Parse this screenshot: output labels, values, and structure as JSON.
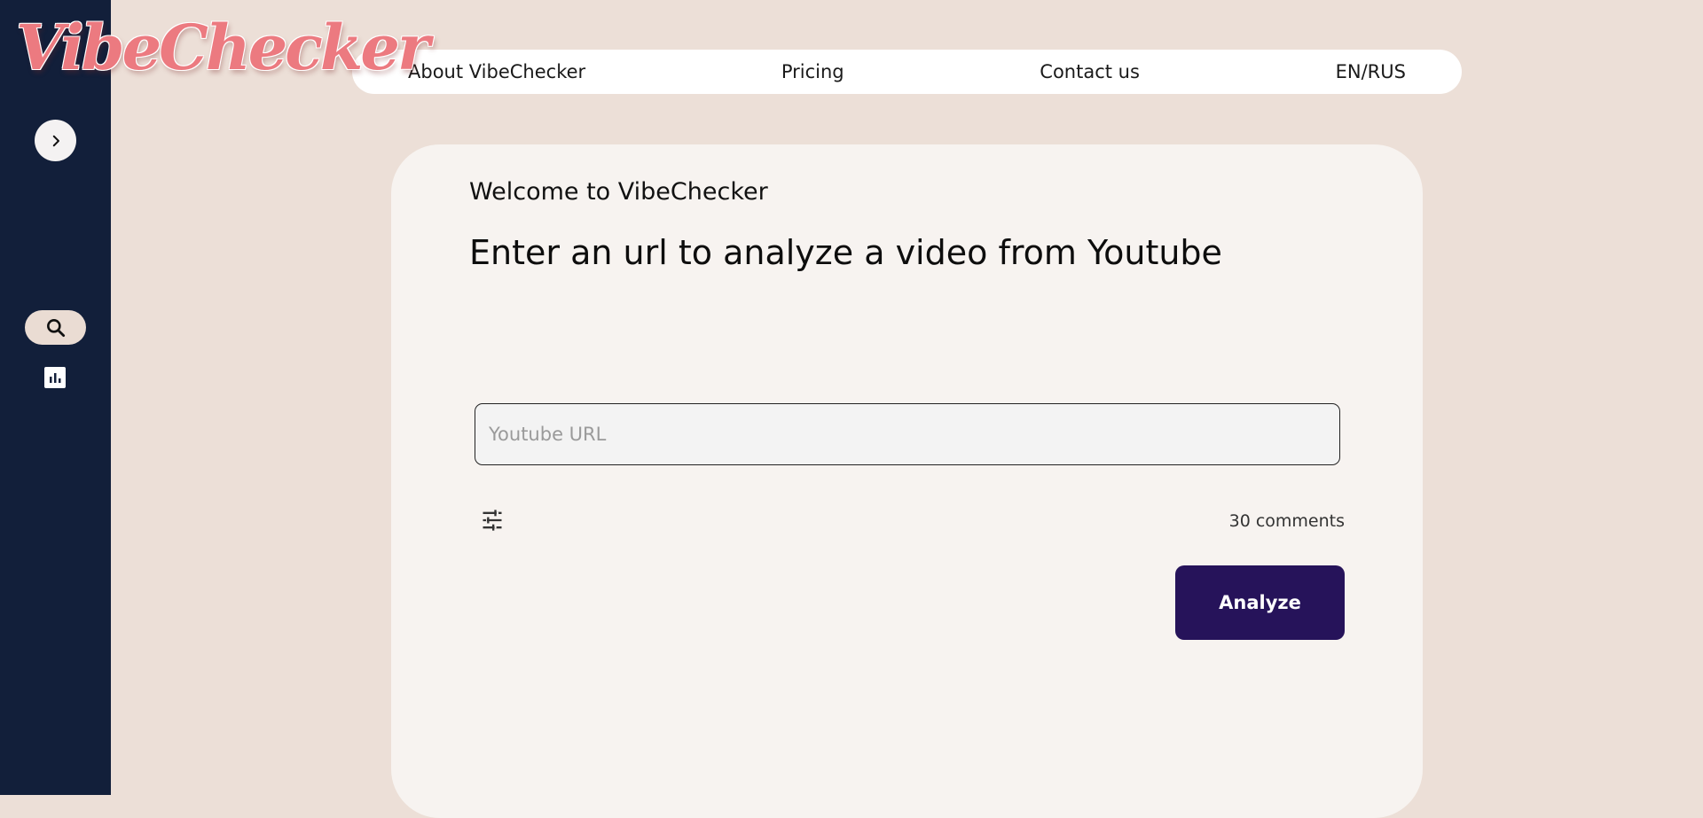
{
  "app": {
    "logo_text": "VibeChecker"
  },
  "sidebar": {
    "items": [
      {
        "icon": "chevron-right-icon"
      },
      {
        "icon": "search-icon",
        "active": true
      },
      {
        "icon": "bar-chart-icon"
      }
    ]
  },
  "topnav": {
    "about": "About VibeChecker",
    "pricing": "Pricing",
    "contact": "Contact us",
    "language": "EN/RUS"
  },
  "main": {
    "welcome": "Welcome to VibeChecker",
    "headline": "Enter an url to analyze a video from Youtube",
    "url_input": {
      "placeholder": "Youtube URL",
      "value": ""
    },
    "filter_icon": "sliders-icon",
    "comments_count": "30 comments",
    "analyze_label": "Analyze"
  },
  "colors": {
    "background": "#ecdfd7",
    "sidebar": "#121f3a",
    "card": "#f7f3f0",
    "logo": "#ec7a80",
    "button": "#26135a"
  }
}
